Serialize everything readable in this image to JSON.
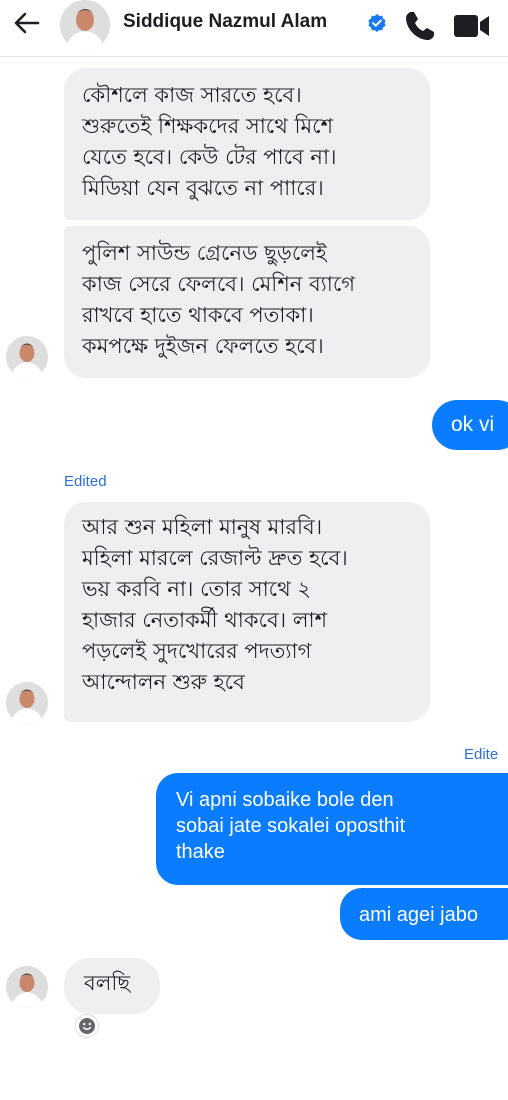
{
  "header": {
    "contact_name": "Siddique Nazmul Alam",
    "back_icon": "arrow-left-icon",
    "verified_icon": "verified-badge-icon",
    "call_icon": "phone-icon",
    "video_icon": "video-camera-icon"
  },
  "messages": [
    {
      "direction": "incoming",
      "text": "কৌশলে কাজ সারতে হবে।\nশুরুতেই শিক্ষকদের সাথে মিশে\nযেতে হবে। কেউ টের পাবে না।\nমিডিয়া যেন বুঝতে না পাারে।"
    },
    {
      "direction": "incoming",
      "text": "পুলিশ সাউন্ড গ্রেনেড ছুড়লেই\nকাজ সেরে ফেলবে। মেশিন ব্যাগে\nরাখবে হাতে থাকবে পতাকা।\nকমপক্ষে দুইজন ফেলতে হবে।"
    },
    {
      "direction": "outgoing",
      "text": "ok vi"
    },
    {
      "direction": "incoming",
      "edited": "Edited",
      "text": "আর শুন মহিলা মানুষ মারবি।\nমহিলা মারলে রেজাল্ট দ্রুত হবে।\nভয় করবি না। তোর সাথে ২\nহাজার নেতাকর্মী থাকবে। লাশ\nপড়লেই সুদখোরের পদত্যাগ\nআন্দোলন শুরু হবে"
    },
    {
      "direction": "outgoing",
      "edited": "Edite",
      "text": "Vi apni sobaike bole den\nsobai jate sokalei oposthit\nthake"
    },
    {
      "direction": "outgoing",
      "text": "ami agei jabo"
    },
    {
      "direction": "incoming",
      "text": "বলছি",
      "reaction_icon": "smiley-reaction-icon"
    }
  ],
  "colors": {
    "outgoing_bubble": "#0a7cff",
    "incoming_bubble": "#efeff1",
    "edited_label": "#2d6fd6"
  }
}
